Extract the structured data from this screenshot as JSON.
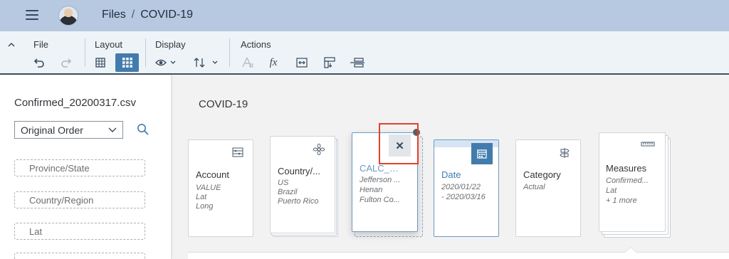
{
  "header": {
    "breadcrumb": [
      "Files",
      "COVID-19"
    ],
    "separator": "/"
  },
  "toolbar": {
    "groups": [
      {
        "label": "File"
      },
      {
        "label": "Layout"
      },
      {
        "label": "Display"
      },
      {
        "label": "Actions"
      }
    ],
    "icons": {
      "collapse": "chevron-up-icon",
      "undo": "undo-icon",
      "redo": "redo-icon",
      "grid": "table-grid-icon",
      "cards": "card-grid-icon",
      "visibility": "eye-icon",
      "sort": "sort-icon",
      "formula": "fx-icon"
    },
    "formula_label": "fx"
  },
  "left_panel": {
    "file_name": "Confirmed_20200317.csv",
    "order_select": "Original Order",
    "fields": [
      "Province/State",
      "Country/Region",
      "Lat"
    ]
  },
  "main": {
    "title": "COVID-19",
    "cards": [
      {
        "title": "Account",
        "items": [
          "VALUE",
          "Lat",
          "Long"
        ]
      },
      {
        "title": "Country/...",
        "items": [
          "US",
          "Brazil",
          "Puerto Rico"
        ]
      },
      {
        "title": "CALC_P...",
        "items": [
          "Jefferson ...",
          "Henan",
          "Fulton Co..."
        ]
      },
      {
        "title": "Date",
        "items": [
          "2020/01/22",
          "- 2020/03/16"
        ]
      },
      {
        "title": "Category",
        "items": [
          "Actual"
        ]
      },
      {
        "title": "Measures",
        "items": [
          "Confirmed...",
          "Lat",
          "+ 1 more"
        ]
      }
    ],
    "close_label": "✕"
  },
  "colors": {
    "shellbar": "#b6c9e0",
    "accent": "#427cac",
    "highlight": "#e4402b"
  }
}
